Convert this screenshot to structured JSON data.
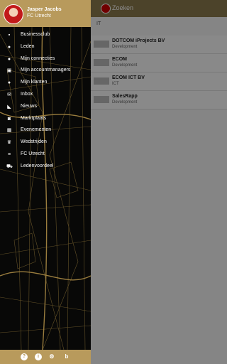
{
  "background": {
    "header_title": "Zoeken",
    "subtitle": "IT",
    "rows": [
      {
        "name": "DOTCOM iProjects BV",
        "category": "Development"
      },
      {
        "name": "ECOM",
        "category": "Development"
      },
      {
        "name": "ECOM ICT BV",
        "category": "ICT"
      },
      {
        "name": "SalesRapp",
        "category": "Development"
      }
    ]
  },
  "profile": {
    "name": "Jasper Jacobs",
    "club": "FC Utrecht"
  },
  "menu": [
    {
      "label": "Businessclub",
      "icon": "briefcase-icon",
      "glyph": "▪"
    },
    {
      "label": "Leden",
      "icon": "person-icon",
      "glyph": "●"
    },
    {
      "label": "Mijn connecties",
      "icon": "people-icon",
      "glyph": "●"
    },
    {
      "label": "Mijn accountmanagers",
      "icon": "contact-card-icon",
      "glyph": "▣"
    },
    {
      "label": "Mijn klanten",
      "icon": "add-person-icon",
      "glyph": "●"
    },
    {
      "label": "Inbox",
      "icon": "mail-icon",
      "glyph": "✉"
    },
    {
      "label": "Nieuws",
      "icon": "rss-icon",
      "glyph": "◣"
    },
    {
      "label": "Marktplaats",
      "icon": "camera-icon",
      "glyph": "◙"
    },
    {
      "label": "Evenementen",
      "icon": "calendar-icon",
      "glyph": "▦"
    },
    {
      "label": "Wedstrijden",
      "icon": "trophy-icon",
      "glyph": "♛"
    },
    {
      "label": "FC Utrecht",
      "icon": "list-icon",
      "glyph": "≡"
    },
    {
      "label": "Ledenvoordeel",
      "icon": "cart-icon",
      "glyph": "⛟"
    }
  ],
  "footer": {
    "help_glyph": "?",
    "info_glyph": "i",
    "settings_glyph": "⚙",
    "brand_glyph": "b"
  },
  "colors": {
    "gold": "#b89a5c",
    "drawer_bg": "#080807"
  }
}
